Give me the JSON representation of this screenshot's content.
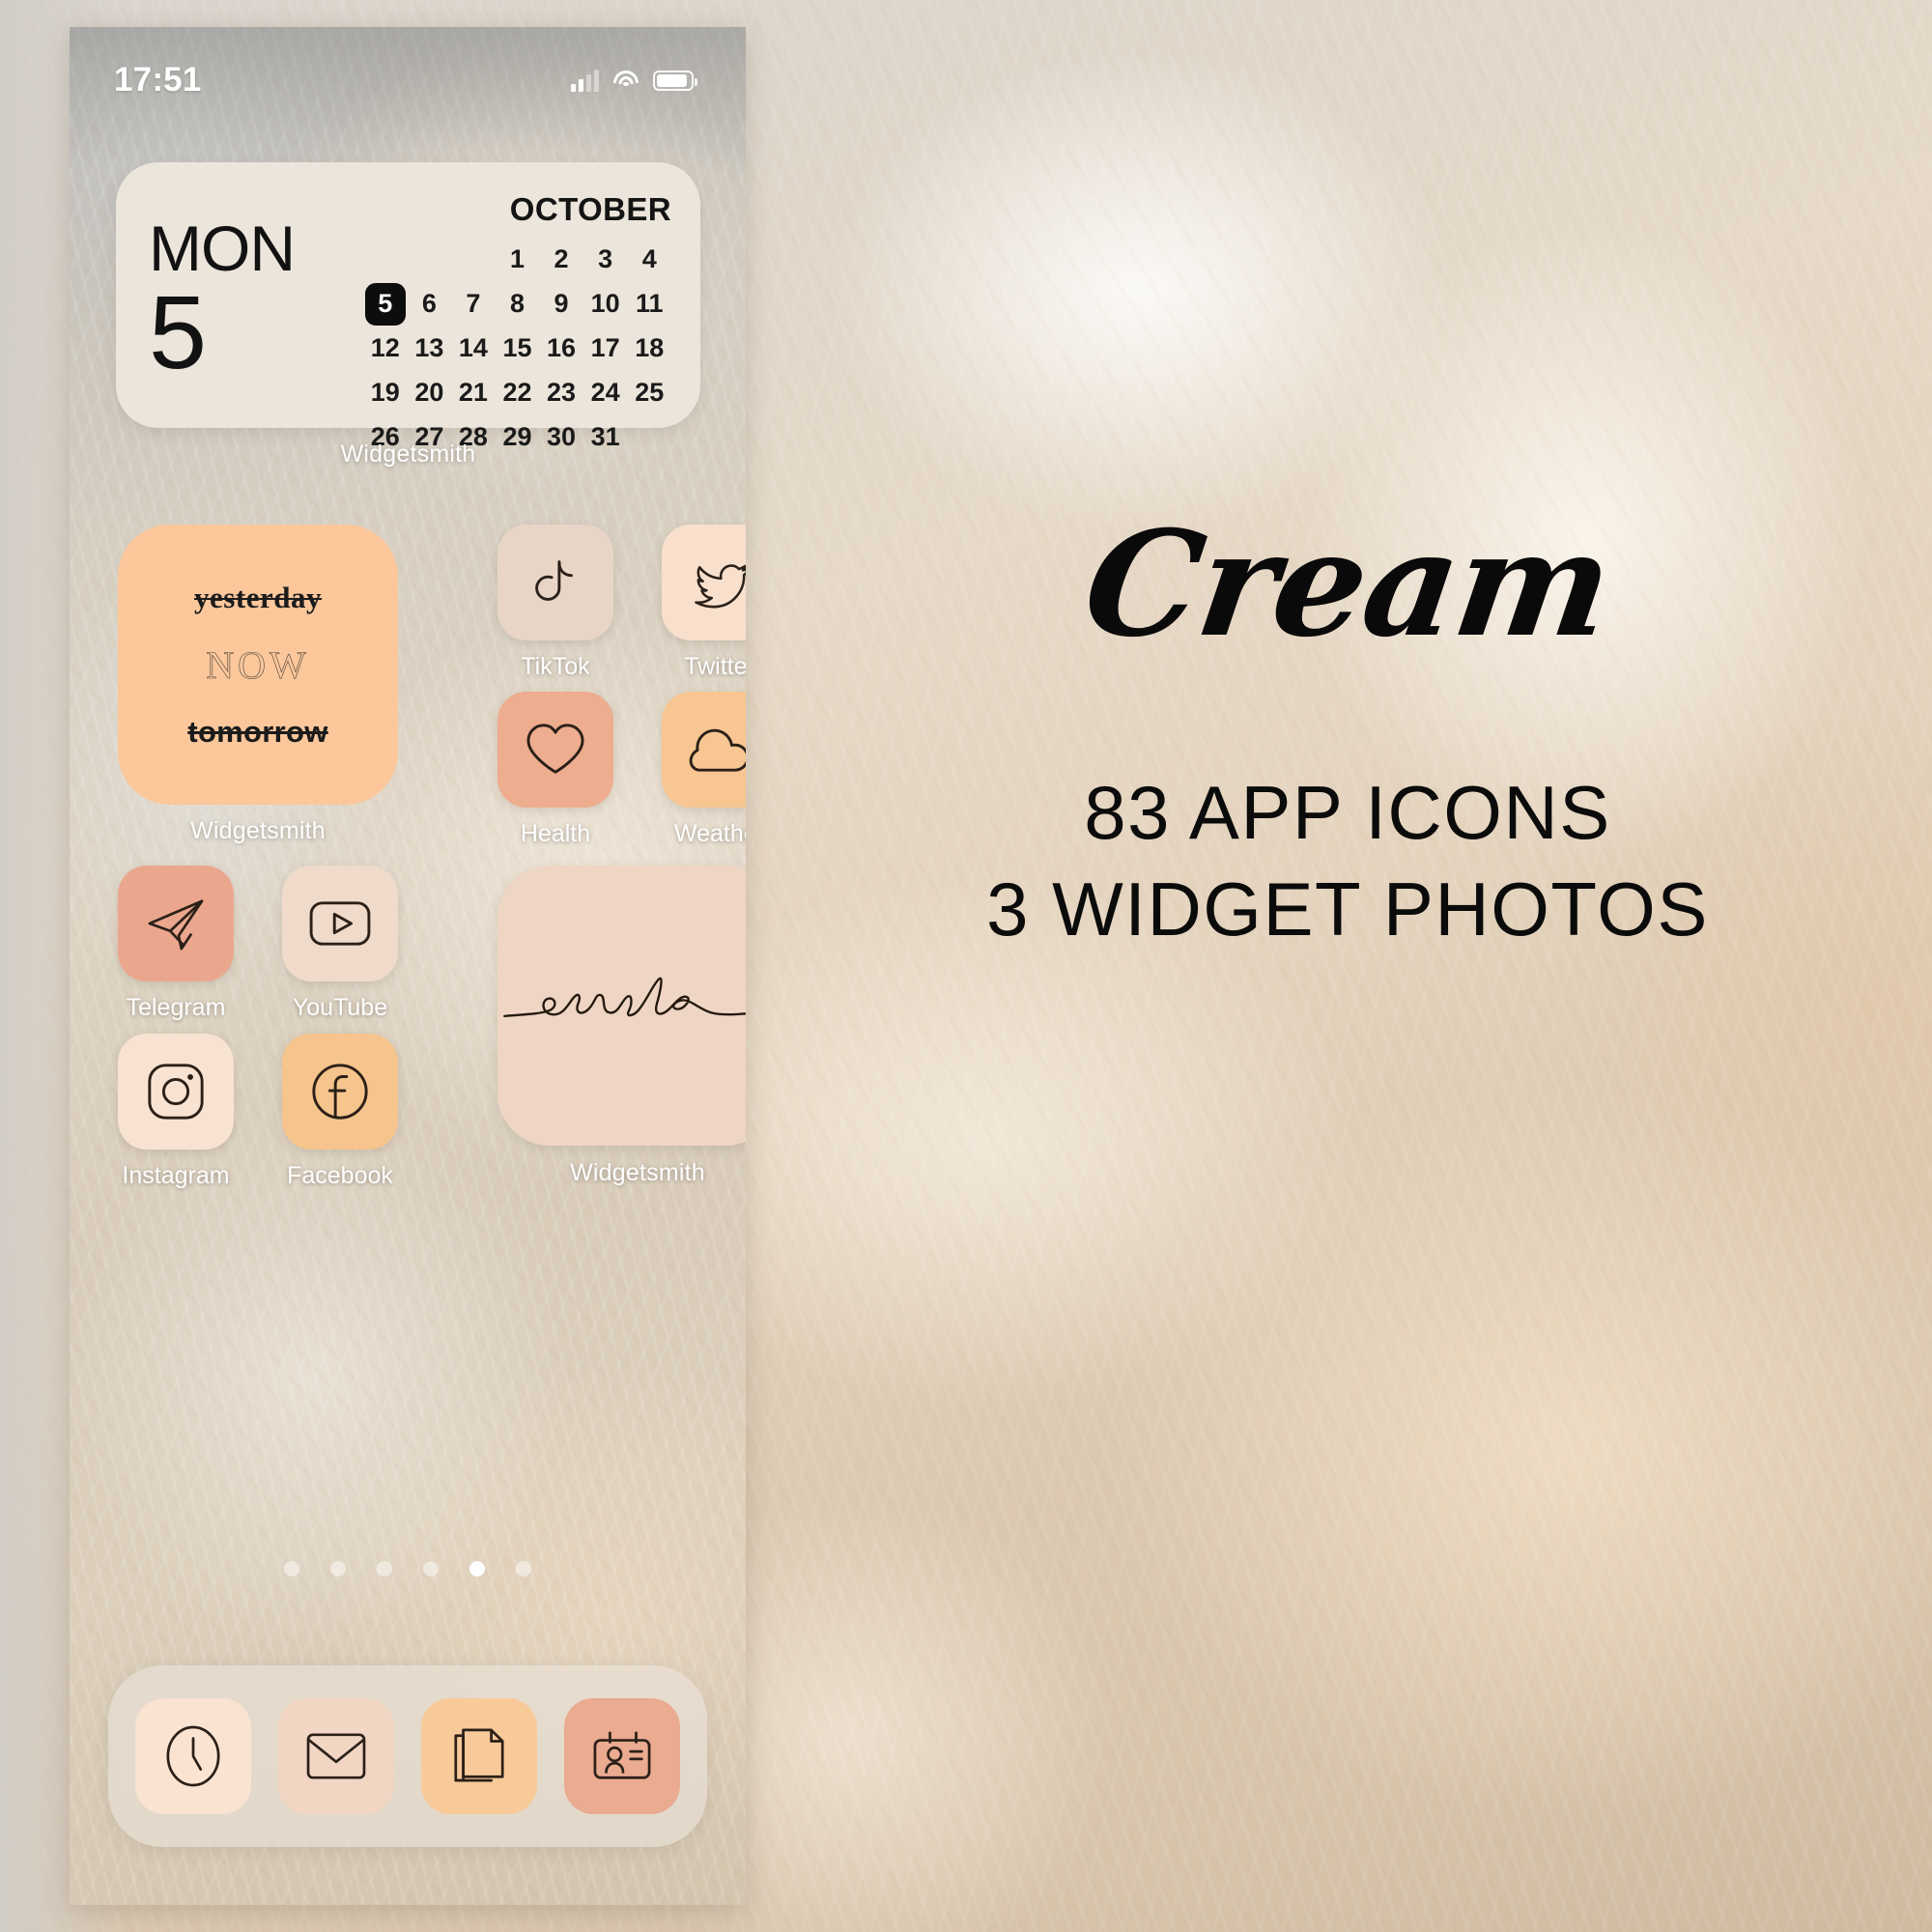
{
  "statusbar": {
    "time": "17:51",
    "signal_icon": "cellular-signal-icon",
    "wifi_icon": "wifi-icon",
    "battery_icon": "battery-icon"
  },
  "calendar_widget": {
    "weekday": "MON",
    "day": "5",
    "month": "OCTOBER",
    "today": 5,
    "leading_blanks": 3,
    "days": [
      1,
      2,
      3,
      4,
      5,
      6,
      7,
      8,
      9,
      10,
      11,
      12,
      13,
      14,
      15,
      16,
      17,
      18,
      19,
      20,
      21,
      22,
      23,
      24,
      25,
      26,
      27,
      28,
      29,
      30,
      31
    ],
    "label": "Widgetsmith"
  },
  "now_widget": {
    "yesterday": "yesterday",
    "now": "NOW",
    "tomorrow": "tomorrow",
    "label": "Widgetsmith"
  },
  "smile_widget": {
    "text": "smile",
    "label": "Widgetsmith"
  },
  "apps": [
    {
      "name": "TikTok",
      "icon": "tiktok-icon",
      "bg": "#e9d5c6"
    },
    {
      "name": "Twitter",
      "icon": "twitter-icon",
      "bg": "#f8e0cd"
    },
    {
      "name": "Health",
      "icon": "heart-icon",
      "bg": "#edad8e"
    },
    {
      "name": "Weather",
      "icon": "cloud-icon",
      "bg": "#f7c692"
    },
    {
      "name": "Telegram",
      "icon": "paper-plane-icon",
      "bg": "#eba78d"
    },
    {
      "name": "YouTube",
      "icon": "youtube-play-icon",
      "bg": "#f0dbcb"
    },
    {
      "name": "Instagram",
      "icon": "camera-icon",
      "bg": "#f8e3d2"
    },
    {
      "name": "Facebook",
      "icon": "facebook-f-icon",
      "bg": "#f6c48d"
    }
  ],
  "dock": [
    {
      "name": "Clock",
      "icon": "clock-icon",
      "bg": "#fae3d1"
    },
    {
      "name": "Mail",
      "icon": "envelope-icon",
      "bg": "#f0d6c3"
    },
    {
      "name": "Notes",
      "icon": "pages-icon",
      "bg": "#f8ca99"
    },
    {
      "name": "Contacts",
      "icon": "contact-card-icon",
      "bg": "#eaab90"
    }
  ],
  "page_dots": {
    "count": 6,
    "active_index": 4
  },
  "promo": {
    "script_title": "Cream",
    "line1": "83 APP ICONS",
    "line2": "3 WIDGET PHOTOS"
  },
  "colors": {
    "widget_cream": "#ece5db",
    "widget_peach": "#fbc79b",
    "widget_blush": "#efd5c3",
    "stroke": "#2b2018"
  }
}
